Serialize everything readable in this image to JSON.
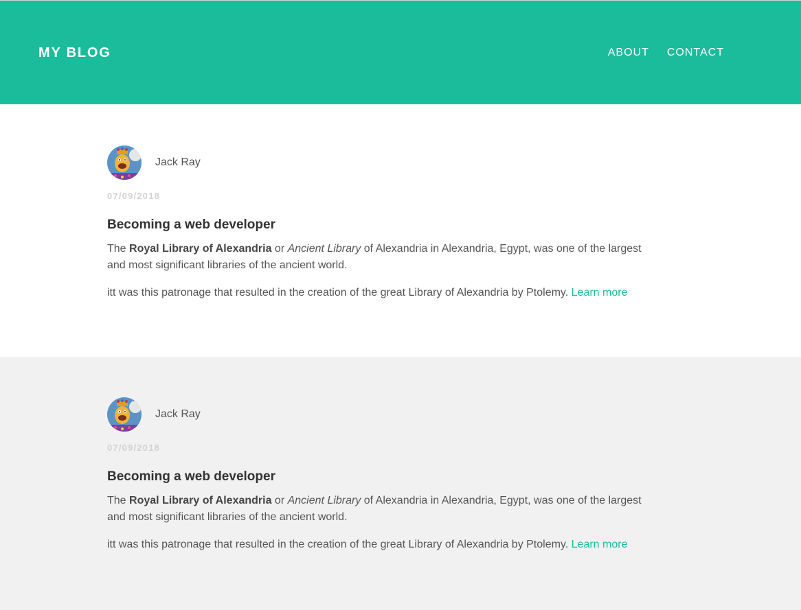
{
  "header": {
    "brand": "MY BLOG",
    "nav": [
      "ABOUT",
      "CONTACT"
    ]
  },
  "colors": {
    "accent": "#1bbc9b",
    "date_gray": "#d2d2d2",
    "alt_section_bg": "#f1f1f1"
  },
  "posts": [
    {
      "author": "Jack Ray",
      "avatar_icon": "cartoon-avatar-icon",
      "date": "07/09/2018",
      "title": "Becoming a web developer",
      "p1": {
        "intro": "The ",
        "bold": "Royal Library of Alexandria",
        "between": " or ",
        "italic": "Ancient Library",
        "rest": " of Alexandria in Alexandria, Egypt, was one of the largest and most significant libraries of the ancient world."
      },
      "p2": {
        "text": "itt was this patronage that resulted in the creation of the great Library of Alexandria by Ptolemy. ",
        "link": "Learn more"
      }
    },
    {
      "author": "Jack Ray",
      "avatar_icon": "cartoon-avatar-icon",
      "date": "07/09/2018",
      "title": "Becoming a web developer",
      "p1": {
        "intro": "The ",
        "bold": "Royal Library of Alexandria",
        "between": " or ",
        "italic": "Ancient Library",
        "rest": " of Alexandria in Alexandria, Egypt, was one of the largest and most significant libraries of the ancient world."
      },
      "p2": {
        "text": "itt was this patronage that resulted in the creation of the great Library of Alexandria by Ptolemy. ",
        "link": "Learn more"
      }
    }
  ]
}
